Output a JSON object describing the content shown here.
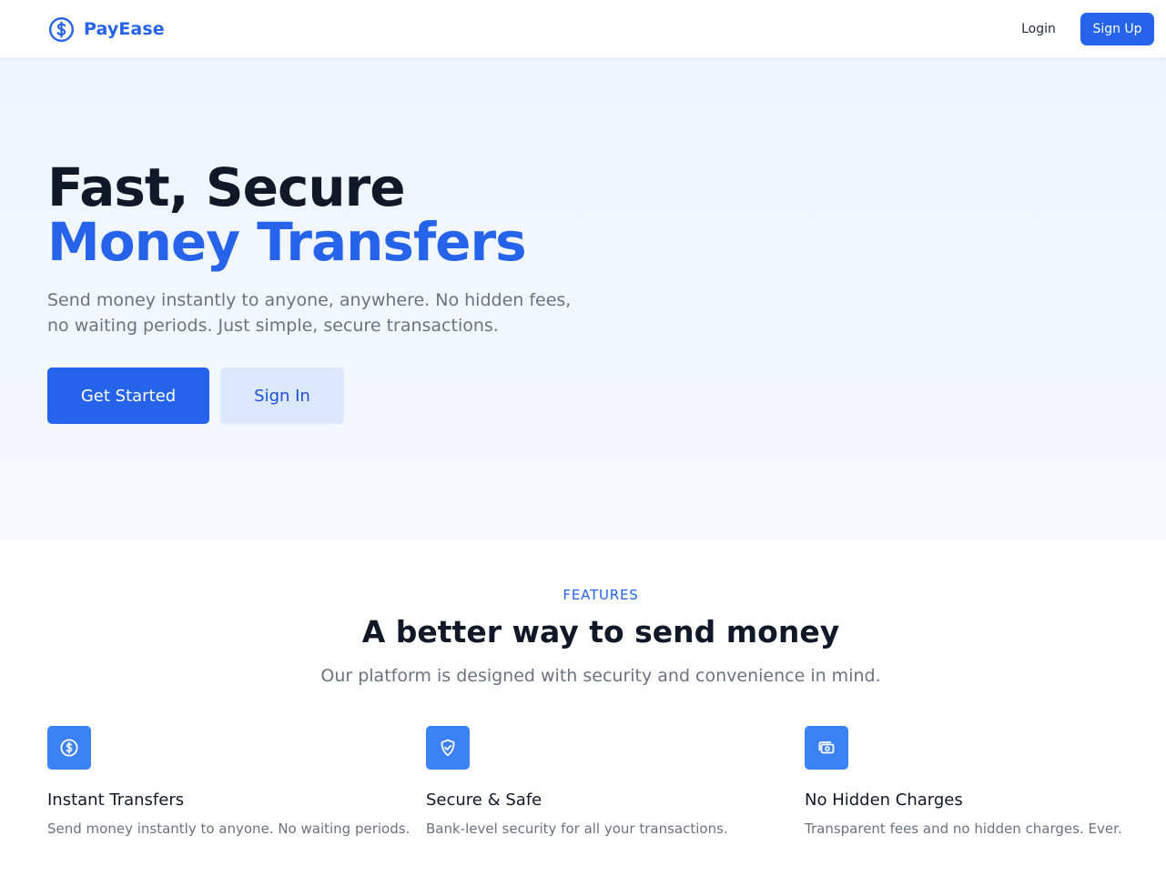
{
  "header": {
    "brand_name": "PayEase",
    "brand_icon": "dollar-circle-icon",
    "login_label": "Login",
    "signup_label": "Sign Up"
  },
  "hero": {
    "title_line1": "Fast, Secure",
    "title_line2": "Money Transfers",
    "subtitle": "Send money instantly to anyone, anywhere. No hidden fees, no waiting periods. Just simple, secure transactions.",
    "primary_button": "Get Started",
    "secondary_button": "Sign In"
  },
  "features": {
    "eyebrow": "FEATURES",
    "heading": "A better way to send money",
    "subheading": "Our platform is designed with security and convenience in mind.",
    "items": [
      {
        "icon": "dollar-circle-icon",
        "title": "Instant Transfers",
        "description": "Send money instantly to anyone. No waiting periods."
      },
      {
        "icon": "shield-check-icon",
        "title": "Secure & Safe",
        "description": "Bank-level security for all your transactions."
      },
      {
        "icon": "banknote-icon",
        "title": "No Hidden Charges",
        "description": "Transparent fees and no hidden charges. Ever."
      }
    ]
  },
  "colors": {
    "brand": "#2563eb",
    "feature_icon_bg": "#3b82f6",
    "hero_bg": "#eef5ff",
    "secondary_button_bg": "#dbe8fe",
    "muted_text": "#6b7280",
    "heading_text": "#111827"
  }
}
